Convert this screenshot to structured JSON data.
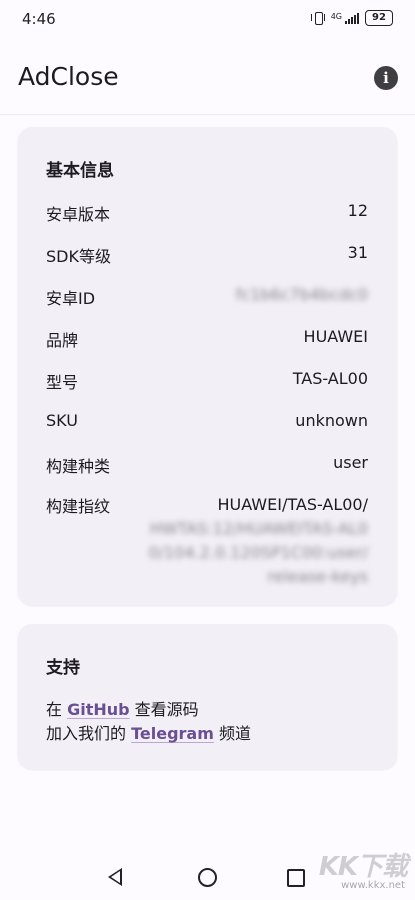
{
  "status_bar": {
    "time": "4:46",
    "network": "4G",
    "battery": "92",
    "icons": [
      "vibrate-icon",
      "signal-icon",
      "battery-icon"
    ]
  },
  "app_bar": {
    "title": "AdClose",
    "info_icon": "i"
  },
  "basic_info": {
    "heading": "基本信息",
    "rows": [
      {
        "label": "安卓版本",
        "value": "12"
      },
      {
        "label": "SDK等级",
        "value": "31"
      },
      {
        "label": "安卓ID",
        "value": "fc1b6c7b4bcdc0"
      },
      {
        "label": "品牌",
        "value": "HUAWEI"
      },
      {
        "label": "型号",
        "value": "TAS-AL00"
      },
      {
        "label": "SKU",
        "value": "unknown"
      },
      {
        "label": "构建种类",
        "value": "user"
      }
    ],
    "fingerprint": {
      "label": "构建指纹",
      "lines": [
        "HUAWEI/TAS-AL00/",
        "HWTAS:12/HUAWEITAS-AL0",
        "0/104.2.0.120SP1C00:user/",
        "release-keys"
      ]
    }
  },
  "support": {
    "heading": "支持",
    "line1": {
      "prefix": "在 ",
      "link": "GitHub",
      "suffix": " 查看源码"
    },
    "line2": {
      "prefix": "加入我们的 ",
      "link": "Telegram",
      "suffix": " 频道"
    }
  },
  "watermark": {
    "logo": "KK下载",
    "url": "www.kkx.net"
  },
  "colors": {
    "background": "#fdfbff",
    "card": "#f3eff6",
    "link": "#6a4f93"
  }
}
